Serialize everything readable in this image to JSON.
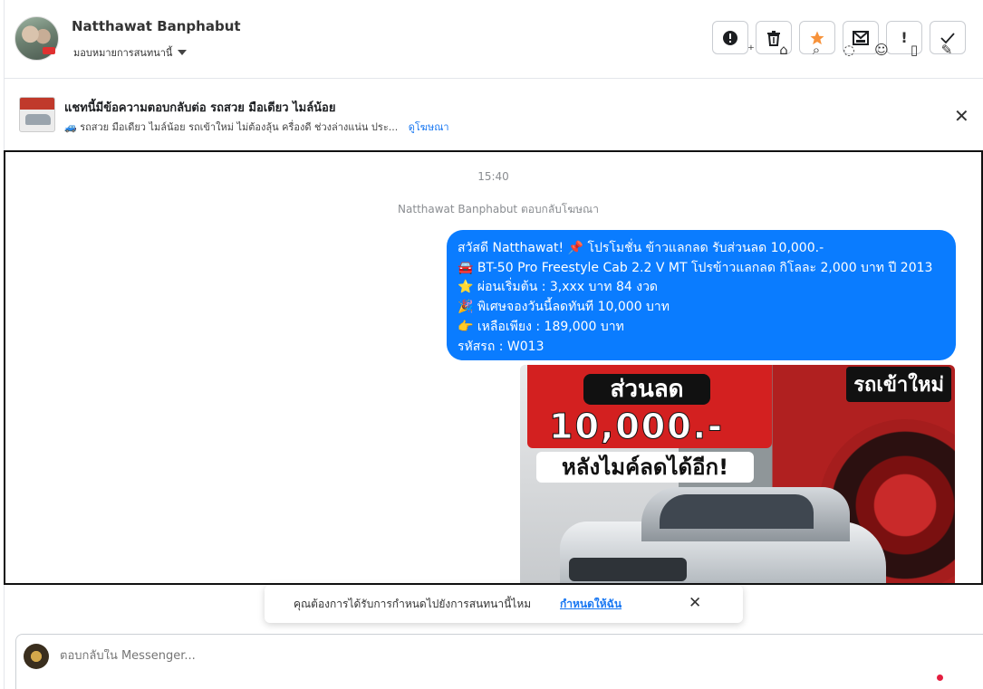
{
  "header": {
    "contact_name": "Natthawat Banphabut",
    "assign_label": "มอบหมายการสนทนานี้",
    "tools": [
      "spam-icon",
      "trash-icon",
      "star-icon",
      "mark-unread-icon",
      "follow-up-icon",
      "done-icon"
    ],
    "star_color": "#f7923a"
  },
  "ad_banner": {
    "title": "แชทนี้มีข้อความตอบกลับต่อ รถสวย มือเดียว ไมล์น้อย",
    "subtitle": "🚙 รถสวย มือเดียว ไมล์น้อย รถเข้าใหม่ ไม่ต้องลุ้น ครื่องดี ช่วงล่างแน่น ประ...",
    "link": "ดูโฆษณา"
  },
  "chat": {
    "time": "15:40",
    "reply_note": "Natthawat Banphabut ตอบกลับโฆษณา",
    "message_lines": [
      "สวัสดี Natthawat! 📌 โปรโมชั่น ข้าวแลกลด รับส่วนลด 10,000.-",
      "🚘 BT-50 Pro Freestyle Cab 2.2 V MT โปรข้าวแลกลด กิโลละ 2,000 บาท ปี 2013",
      "⭐ ผ่อนเริ่มต้น : 3,xxx บาท 84 งวด",
      "🎉 พิเศษจองวันนี้ลดทันที 10,000 บาท",
      "👉 เหลือเพียง : 189,000 บาท",
      "รหัสรถ : W013"
    ],
    "bubble_color": "#0a7cff",
    "image": {
      "discount_label": "ส่วนลด",
      "discount_amount": "10,000.-",
      "after_label": "หลังไมค์ลดได้อีก!",
      "new_car_label": "รถเข้าใหม่"
    }
  },
  "toast": {
    "text": "คุณต้องการได้รับการกำหนดไปยังการสนทนานี้ไหม",
    "link": "กำหนดให้ฉัน"
  },
  "composer": {
    "placeholder": "ตอบกลับใน Messenger...",
    "tools": [
      "add-contact-icon",
      "bag-icon",
      "attach-icon",
      "chat-icon",
      "emoji-icon",
      "ticket-icon",
      "pin-icon"
    ]
  }
}
